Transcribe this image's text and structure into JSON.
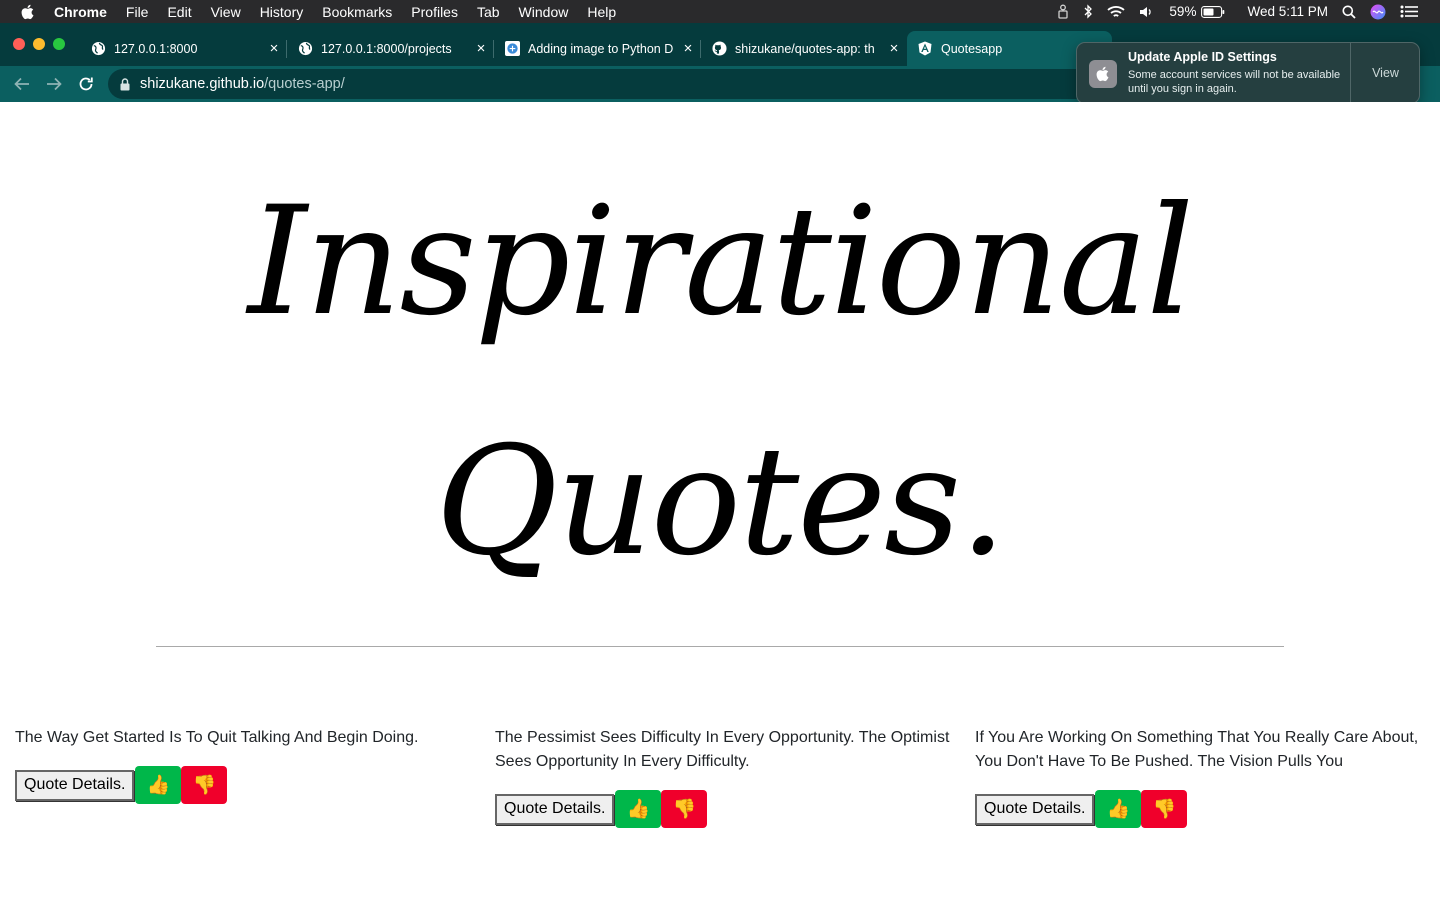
{
  "menubar": {
    "app_name": "Chrome",
    "items": [
      "File",
      "Edit",
      "View",
      "History",
      "Bookmarks",
      "Profiles",
      "Tab",
      "Window",
      "Help"
    ],
    "battery": "59%",
    "clock": "Wed 5:11 PM"
  },
  "tabs": [
    {
      "title": "127.0.0.1:8000",
      "close": "×",
      "icon": "globe-icon"
    },
    {
      "title": "127.0.0.1:8000/projects",
      "close": "×",
      "icon": "globe-icon"
    },
    {
      "title": "Adding image to Python D",
      "close": "×",
      "icon": "stackoverflow-icon"
    },
    {
      "title": "shizukane/quotes-app: th",
      "close": "×",
      "icon": "github-icon"
    },
    {
      "title": "Quotesapp",
      "icon": "angular-icon"
    }
  ],
  "toolbar": {
    "url_host": "shizukane.github.io",
    "url_path": "/quotes-app/"
  },
  "notification": {
    "title": "Update Apple ID Settings",
    "body": "Some account services will not be available until you sign in again.",
    "action": "View"
  },
  "page": {
    "title": "Inspirational Quotes.",
    "quotes": [
      {
        "text": "The Way Get Started Is To Quit Talking And Begin Doing.",
        "details_label": "Quote Details.",
        "upvote": "👍",
        "downvote": "👎"
      },
      {
        "text": "The Pessimist Sees Difficulty In Every Opportunity. The Optimist Sees Opportunity In Every Difficulty.",
        "details_label": "Quote Details.",
        "upvote": "👍",
        "downvote": "👎"
      },
      {
        "text": "If You Are Working On Something That You Really Care About, You Don't Have To Be Pushed. The Vision Pulls You",
        "details_label": "Quote Details.",
        "upvote": "👍",
        "downvote": "👎"
      }
    ]
  },
  "colors": {
    "tab_strip": "#053b3d",
    "toolbar": "#0b5f60",
    "upvote": "#00b74a",
    "downvote": "#f0002b"
  }
}
